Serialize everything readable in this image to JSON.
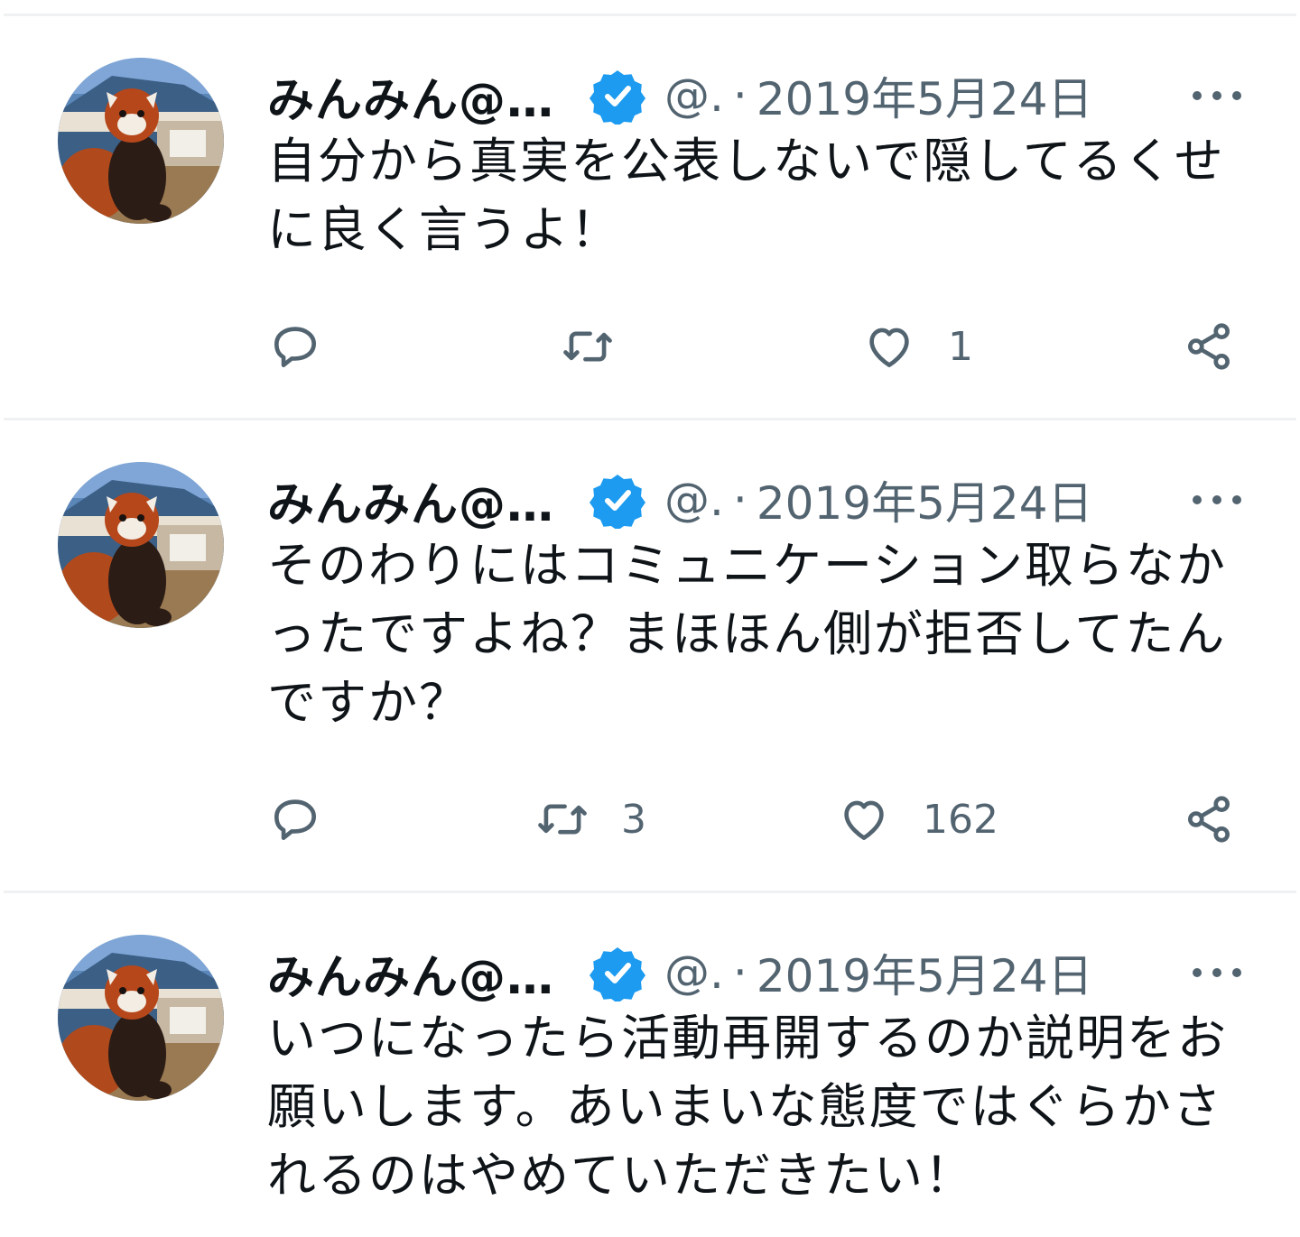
{
  "tweets": [
    {
      "name": "みんみん@…",
      "handle": "@.",
      "separator": "·",
      "date": "2019年5月24日",
      "text": "自分から真実を公表しないで隠してるくせに良く言うよ！",
      "reply_count": "",
      "retweet_count": "",
      "like_count": "1"
    },
    {
      "name": "みんみん@…",
      "handle": "@.",
      "separator": "·",
      "date": "2019年5月24日",
      "text": "そのわりにはコミュニケーション取らなかったですよね？まほほん側が拒否してたんですか？",
      "reply_count": "",
      "retweet_count": "3",
      "like_count": "162"
    },
    {
      "name": "みんみん@…",
      "handle": "@.",
      "separator": "·",
      "date": "2019年5月24日",
      "text": "いつになったら活動再開するのか説明をお願いします。あいまいな態度ではぐらかされるのはやめていただきたい！",
      "reply_count": "",
      "retweet_count": "",
      "like_count": ""
    }
  ],
  "colors": {
    "verified_blue": "#1d9bf0",
    "secondary_text": "#536471",
    "divider": "#eff1f3"
  },
  "icons": [
    "reply-icon",
    "retweet-icon",
    "like-icon",
    "share-icon",
    "more-icon",
    "verified-badge-icon"
  ]
}
